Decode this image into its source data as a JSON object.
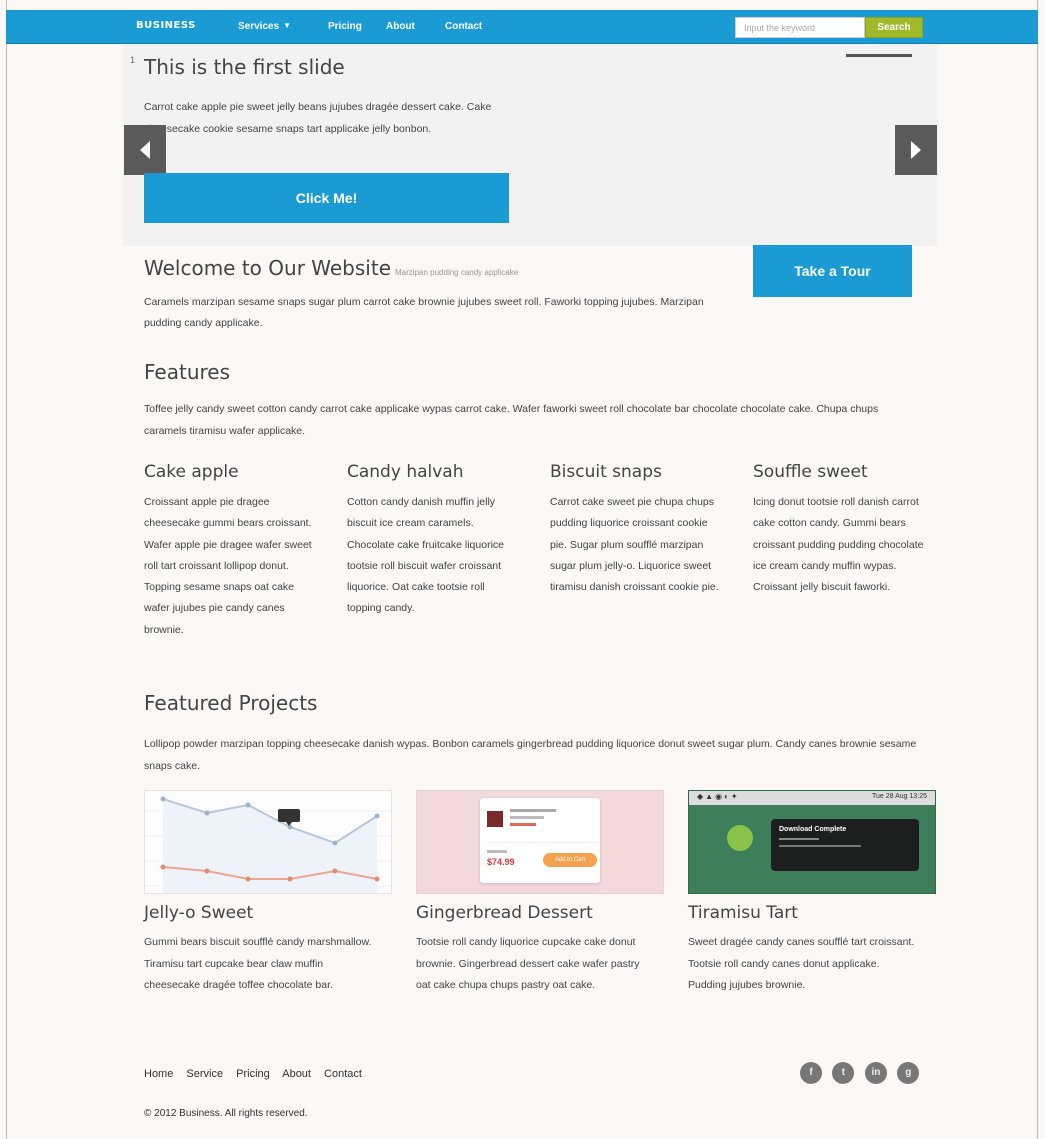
{
  "brand": "BUSINESS",
  "nav": {
    "services": "Services",
    "pricing": "Pricing",
    "about": "About",
    "contact": "Contact"
  },
  "search": {
    "placeholder": "Input the keyword",
    "button": "Search"
  },
  "carousel": {
    "indicator": "1",
    "title": "This is the first slide",
    "text": "Carrot cake apple pie sweet jelly beans jujubes dragée dessert cake. Cake cheesecake cookie sesame snaps tart applicake jelly bonbon.",
    "button": "Click Me!"
  },
  "welcome": {
    "title": "Welcome to Our Website",
    "subtitle": "Marzipan pudding candy applicake",
    "text": "Caramels marzipan sesame snaps sugar plum carrot cake brownie jujubes sweet roll. Faworki topping jujubes. Marzipan pudding candy applicake.",
    "tour_button": "Take a Tour"
  },
  "features": {
    "title": "Features",
    "text": "Toffee jelly candy sweet cotton candy carrot cake applicake wypas carrot cake. Wafer faworki sweet roll chocolate bar chocolate chocolate cake. Chupa chups caramels tiramisu wafer applicake.",
    "items": [
      {
        "title": "Cake apple",
        "text": "Croissant apple pie dragee cheesecake gummi bears croissant. Wafer apple pie dragee wafer sweet roll tart croissant lollipop donut. Topping sesame snaps oat cake wafer jujubes pie candy canes brownie."
      },
      {
        "title": "Candy halvah",
        "text": "Cotton candy danish muffin jelly biscuit ice cream caramels. Chocolate cake fruitcake liquorice tootsie roll biscuit wafer croissant liquorice. Oat cake tootsie roll topping candy."
      },
      {
        "title": "Biscuit snaps",
        "text": "Carrot cake sweet pie chupa chups pudding liquorice croissant cookie pie. Sugar plum soufflé marzipan sugar plum jelly-o. Liquorice sweet tiramisu danish croissant cookie pie."
      },
      {
        "title": "Souffle sweet",
        "text": "Icing donut tootsie roll danish carrot cake cotton candy. Gummi bears croissant pudding pudding chocolate ice cream candy muffin wypas. Croissant jelly biscuit faworki."
      }
    ]
  },
  "projects": {
    "title": "Featured Projects",
    "text": "Lollipop powder marzipan topping cheesecake danish wypas. Bonbon caramels gingerbread pudding liquorice donut sweet sugar plum. Candy canes brownie sesame snaps cake.",
    "items": [
      {
        "title": "Jelly-o Sweet",
        "text": "Gummi bears biscuit soufflé candy marshmallow. Tiramisu tart cupcake bear claw muffin cheesecake dragée toffee chocolate bar."
      },
      {
        "title": "Gingerbread Dessert",
        "text": "Tootsie roll candy liquorice cupcake cake donut brownie. Gingerbread dessert cake wafer pastry oat cake chupa chups pastry oat cake."
      },
      {
        "title": "Tiramisu Tart",
        "text": "Sweet dragée candy canes soufflé tart croissant. Tootsie roll candy canes donut applicake. Pudding jujubes brownie."
      }
    ],
    "thumb2": {
      "price": "$74.99",
      "button": "Add to Cart"
    },
    "thumb3": {
      "time": "Tue 28 Aug  13:25",
      "notice": "Download Complete"
    }
  },
  "footer": {
    "links": [
      "Home",
      "Service",
      "Pricing",
      "About",
      "Contact"
    ],
    "social": [
      "f",
      "t",
      "in",
      "g"
    ],
    "copyright": "© 2012 Business. All rights reserved."
  },
  "colors": {
    "primary": "#1a9bd4",
    "search_button": "#a0b92a",
    "arrow": "#5a5a5a"
  }
}
